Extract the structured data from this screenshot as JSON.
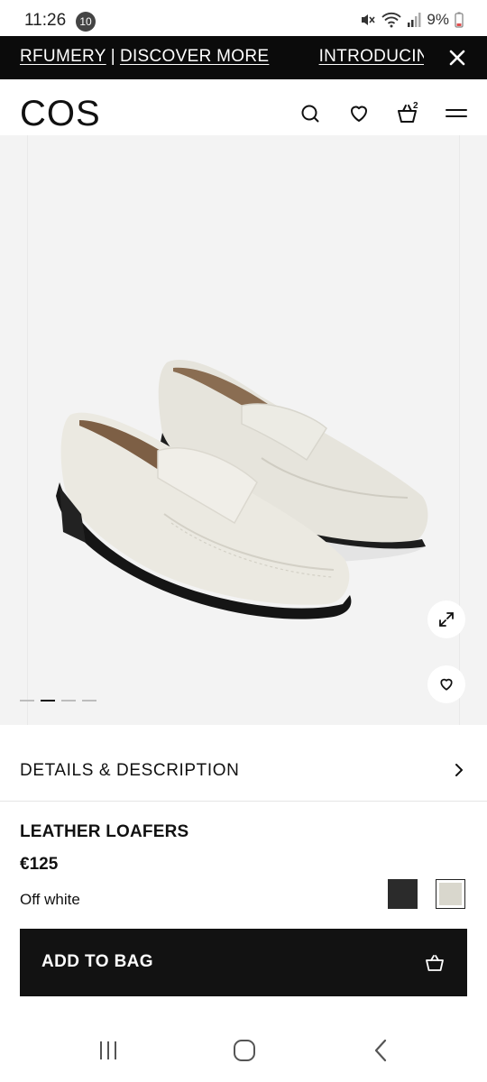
{
  "status_bar": {
    "time": "11:26",
    "notification_count": "10",
    "battery": "9%"
  },
  "promo": {
    "left_fragment": "RFUMERY",
    "separator": "|",
    "discover_more": "DISCOVER MORE",
    "introducing": "INTRODUCING"
  },
  "header": {
    "logo": "COS",
    "cart_count": "2"
  },
  "gallery": {
    "image_subject": "off white leather loafers",
    "slide_count": 4,
    "active_slide": 2
  },
  "details": {
    "label": "DETAILS & DESCRIPTION"
  },
  "product": {
    "name": "LEATHER LOAFERS",
    "price": "€125",
    "color": "Off white",
    "swatches": [
      {
        "name": "black",
        "color": "#2b2b2b"
      },
      {
        "name": "off-white",
        "color": "#d9d7cd",
        "selected": true
      }
    ]
  },
  "cta": {
    "add_to_bag": "ADD TO BAG"
  },
  "colors": {
    "banner_bg": "#0b0b0b",
    "button_bg": "#121212",
    "gallery_bg": "#f3f3f3"
  }
}
